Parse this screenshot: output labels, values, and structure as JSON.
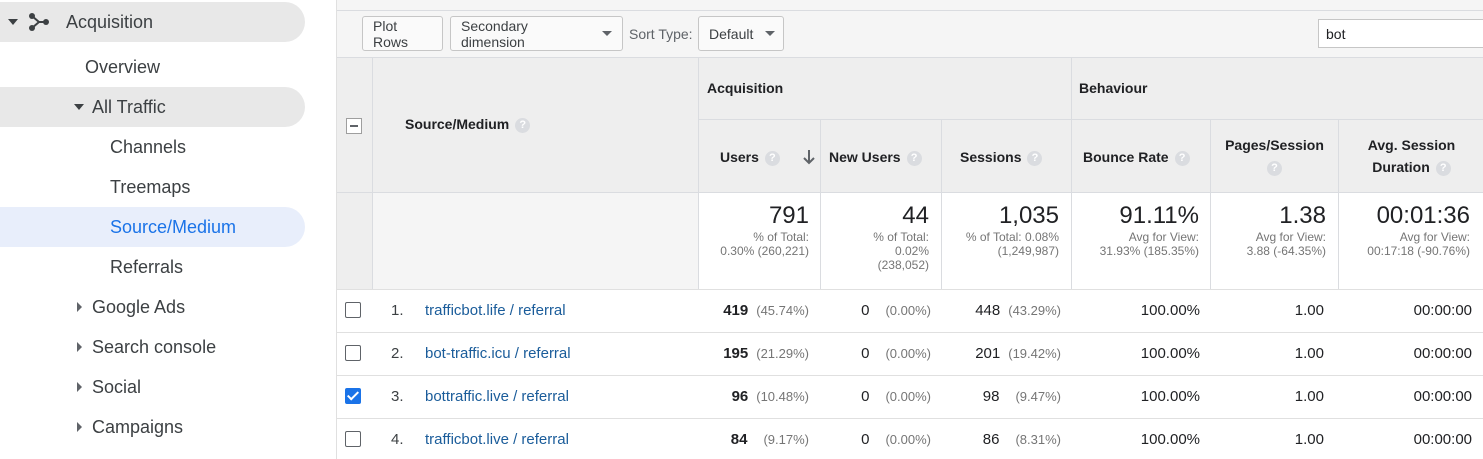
{
  "sidebar": {
    "acquisition": "Acquisition",
    "overview": "Overview",
    "all_traffic": "All Traffic",
    "channels": "Channels",
    "treemaps": "Treemaps",
    "source_medium": "Source/Medium",
    "referrals": "Referrals",
    "google_ads": "Google Ads",
    "search_console": "Search console",
    "social": "Social",
    "campaigns": "Campaigns"
  },
  "toolbar": {
    "plot_rows": "Plot Rows",
    "secondary_dimension": "Secondary dimension",
    "sort_type_label": "Sort Type:",
    "sort_type_value": "Default",
    "search_value": "bot"
  },
  "table": {
    "dimension_header": "Source/Medium",
    "group_acquisition": "Acquisition",
    "group_behaviour": "Behaviour",
    "col_users": "Users",
    "col_new_users": "New Users",
    "col_sessions": "Sessions",
    "col_bounce_rate": "Bounce Rate",
    "col_pages_session": "Pages/Session",
    "col_avg_duration_1": "Avg. Session",
    "col_avg_duration_2": "Duration",
    "help": "?",
    "totals": {
      "users": "791",
      "users_sub1": "% of Total:",
      "users_sub2": "0.30% (260,221)",
      "new_users": "44",
      "new_users_sub1": "% of Total:",
      "new_users_sub2": "0.02%",
      "new_users_sub3": "(238,052)",
      "sessions": "1,035",
      "sessions_sub1": "% of Total: 0.08%",
      "sessions_sub2": "(1,249,987)",
      "bounce": "91.11%",
      "bounce_sub1": "Avg for View:",
      "bounce_sub2": "31.93% (185.35%)",
      "pages": "1.38",
      "pages_sub1": "Avg for View:",
      "pages_sub2": "3.88 (-64.35%)",
      "duration": "00:01:36",
      "duration_sub1": "Avg for View:",
      "duration_sub2": "00:17:18 (-90.76%)"
    },
    "rows": [
      {
        "idx": "1.",
        "source": "trafficbot.life / referral",
        "users": "419",
        "users_pct": "(45.74%)",
        "new_users": "0",
        "new_users_pct": "(0.00%)",
        "sessions": "448",
        "sessions_pct": "(43.29%)",
        "bounce": "100.00%",
        "pages": "1.00",
        "duration": "00:00:00",
        "checked": false
      },
      {
        "idx": "2.",
        "source": "bot-traffic.icu / referral",
        "users": "195",
        "users_pct": "(21.29%)",
        "new_users": "0",
        "new_users_pct": "(0.00%)",
        "sessions": "201",
        "sessions_pct": "(19.42%)",
        "bounce": "100.00%",
        "pages": "1.00",
        "duration": "00:00:00",
        "checked": false
      },
      {
        "idx": "3.",
        "source": "bottraffic.live / referral",
        "users": "96",
        "users_pct": "(10.48%)",
        "new_users": "0",
        "new_users_pct": "(0.00%)",
        "sessions": "98",
        "sessions_pct": "(9.47%)",
        "bounce": "100.00%",
        "pages": "1.00",
        "duration": "00:00:00",
        "checked": true
      },
      {
        "idx": "4.",
        "source": "trafficbot.live / referral",
        "users": "84",
        "users_pct": "(9.17%)",
        "new_users": "0",
        "new_users_pct": "(0.00%)",
        "sessions": "86",
        "sessions_pct": "(8.31%)",
        "bounce": "100.00%",
        "pages": "1.00",
        "duration": "00:00:00",
        "checked": false
      }
    ]
  }
}
